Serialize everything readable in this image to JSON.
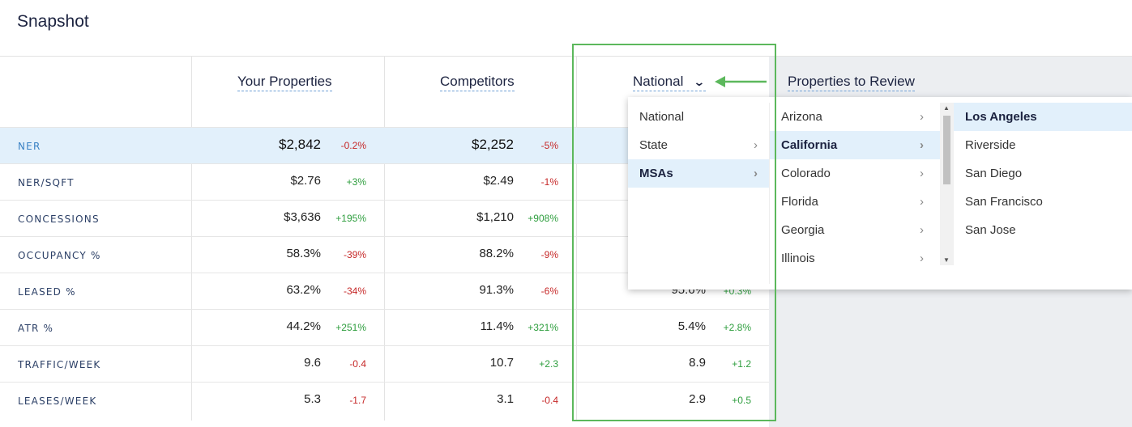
{
  "page": {
    "title": "Snapshot"
  },
  "columns": {
    "yours": "Your Properties",
    "competitors": "Competitors",
    "national": "National",
    "review": "Properties to Review"
  },
  "rows": [
    {
      "label": "NER",
      "yours": "$2,842",
      "yours_chg": "-0.2%",
      "comp": "$2,252",
      "comp_chg": "-5%",
      "nat": "",
      "nat_chg": ""
    },
    {
      "label": "NER/SQFT",
      "yours": "$2.76",
      "yours_chg": "+3%",
      "comp": "$2.49",
      "comp_chg": "-1%",
      "nat": "",
      "nat_chg": ""
    },
    {
      "label": "CONCESSIONS",
      "yours": "$3,636",
      "yours_chg": "+195%",
      "comp": "$1,210",
      "comp_chg": "+908%",
      "nat": "",
      "nat_chg": ""
    },
    {
      "label": "OCCUPANCY %",
      "yours": "58.3%",
      "yours_chg": "-39%",
      "comp": "88.2%",
      "comp_chg": "-9%",
      "nat": "",
      "nat_chg": ""
    },
    {
      "label": "LEASED %",
      "yours": "63.2%",
      "yours_chg": "-34%",
      "comp": "91.3%",
      "comp_chg": "-6%",
      "nat": "95.6%",
      "nat_chg": "+0.3%"
    },
    {
      "label": "ATR %",
      "yours": "44.2%",
      "yours_chg": "+251%",
      "comp": "11.4%",
      "comp_chg": "+321%",
      "nat": "5.4%",
      "nat_chg": "+2.8%"
    },
    {
      "label": "TRAFFIC/WEEK",
      "yours": "9.6",
      "yours_chg": "-0.4",
      "comp": "10.7",
      "comp_chg": "+2.3",
      "nat": "8.9",
      "nat_chg": "+1.2"
    },
    {
      "label": "LEASES/WEEK",
      "yours": "5.3",
      "yours_chg": "-1.7",
      "comp": "3.1",
      "comp_chg": "-0.4",
      "nat": "2.9",
      "nat_chg": "+0.5"
    }
  ],
  "menu": {
    "level1": [
      "National",
      "State",
      "MSAs"
    ],
    "level2": [
      "Arizona",
      "California",
      "Colorado",
      "Florida",
      "Georgia",
      "Illinois"
    ],
    "level3": [
      "Los Angeles",
      "Riverside",
      "San Diego",
      "San Francisco",
      "San Jose"
    ]
  },
  "colors": {
    "positive": "#2e9e3e",
    "negative": "#c62828",
    "highlight": "#e2f0fb",
    "annotation": "#5cb85c"
  },
  "icons": {
    "dropdown": "chevron-down-icon",
    "submenu": "chevron-right-icon"
  }
}
